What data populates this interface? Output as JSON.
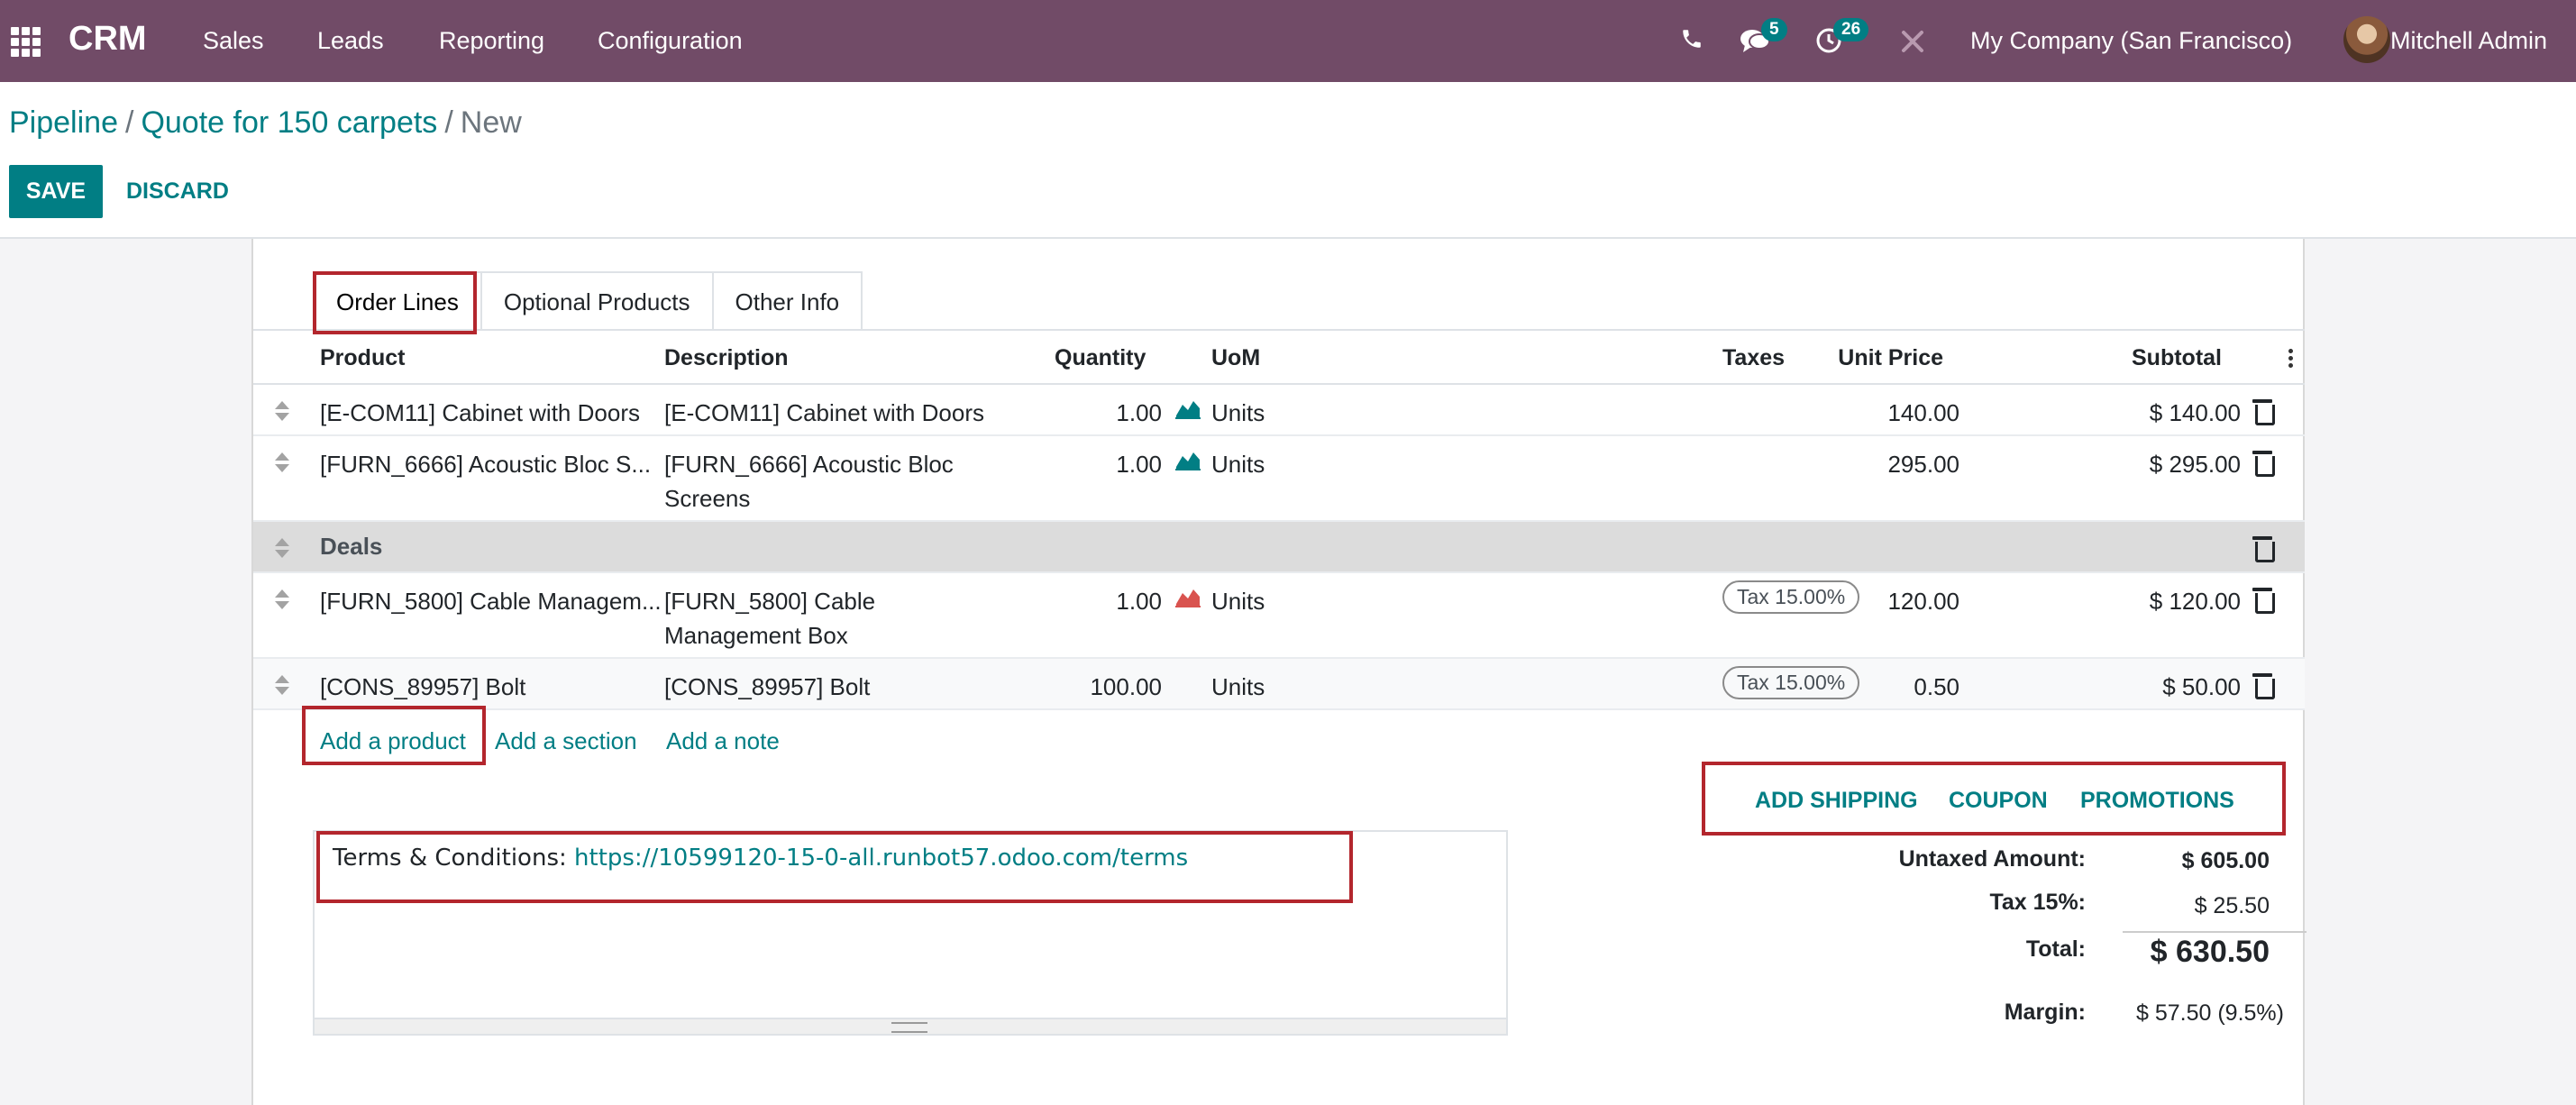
{
  "navbar": {
    "brand": "CRM",
    "menu": [
      "Sales",
      "Leads",
      "Reporting",
      "Configuration"
    ],
    "chat_count": "5",
    "activity_count": "26",
    "company": "My Company (San Francisco)",
    "user": "Mitchell Admin"
  },
  "breadcrumb": {
    "items": [
      "Pipeline",
      "Quote for 150 carpets"
    ],
    "current": "New",
    "separator": "/"
  },
  "actions": {
    "save": "SAVE",
    "discard": "DISCARD"
  },
  "tabs": [
    "Order Lines",
    "Optional Products",
    "Other Info"
  ],
  "columns": {
    "product": "Product",
    "description": "Description",
    "quantity": "Quantity",
    "uom": "UoM",
    "unit_price": "Unit Price",
    "taxes": "Taxes",
    "subtotal": "Subtotal"
  },
  "lines": [
    {
      "product": "[E-COM11] Cabinet with Doors",
      "description": [
        "[E-COM11] Cabinet with Doors"
      ],
      "quantity": "1.00",
      "uom": "Units",
      "unit_price": "140.00",
      "tax": "",
      "subtotal": "$ 140.00",
      "forecast_color": "#017e84"
    },
    {
      "product": "[FURN_6666] Acoustic Bloc S...",
      "description": [
        "[FURN_6666] Acoustic Bloc",
        "Screens"
      ],
      "quantity": "1.00",
      "uom": "Units",
      "unit_price": "295.00",
      "tax": "",
      "subtotal": "$ 295.00",
      "forecast_color": "#017e84"
    },
    {
      "section": "Deals"
    },
    {
      "product": "[FURN_5800] Cable Managem...",
      "description": [
        "[FURN_5800] Cable",
        "Management Box"
      ],
      "quantity": "1.00",
      "uom": "Units",
      "unit_price": "120.00",
      "tax": "Tax 15.00%",
      "subtotal": "$ 120.00",
      "forecast_color": "#d9534f"
    },
    {
      "product": "[CONS_89957] Bolt",
      "description": [
        "[CONS_89957] Bolt"
      ],
      "quantity": "100.00",
      "uom": "Units",
      "unit_price": "0.50",
      "tax": "Tax 15.00%",
      "subtotal": "$ 50.00",
      "forecast_color": ""
    }
  ],
  "add_links": {
    "product": "Add a product",
    "section": "Add a section",
    "note": "Add a note"
  },
  "shipping_buttons": {
    "shipping": "ADD SHIPPING",
    "coupon": "COUPON",
    "promotions": "PROMOTIONS"
  },
  "terms": {
    "label": "Terms & Conditions:",
    "url": "https://10599120-15-0-all.runbot57.odoo.com/terms"
  },
  "totals": {
    "untaxed_label": "Untaxed Amount:",
    "untaxed": "$ 605.00",
    "tax_label": "Tax 15%:",
    "tax": "$ 25.50",
    "total_label": "Total:",
    "total": "$ 630.50",
    "margin_label": "Margin:",
    "margin": "$ 57.50 (9.5%)"
  },
  "colors": {
    "navbar": "#714b67",
    "accent": "#017e84",
    "highlight": "#b3262d"
  }
}
